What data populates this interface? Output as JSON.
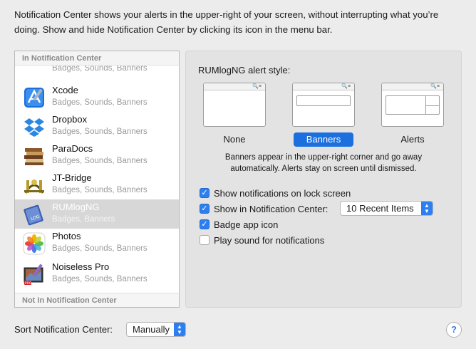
{
  "intro_text": "Notification Center shows your alerts in the upper-right of your screen, without interrupting what you’re doing. Show and hide Notification Center by clicking its icon in the menu bar.",
  "app_list": {
    "section_in": "In Notification Center",
    "section_out": "Not In Notification Center",
    "partial_top_sub": "Badges, Sounds, Banners",
    "apps": [
      {
        "name": "Xcode",
        "sub": "Badges, Sounds, Banners",
        "icon": "xcode-icon",
        "selected": false
      },
      {
        "name": "Dropbox",
        "sub": "Badges, Sounds, Banners",
        "icon": "dropbox-icon",
        "selected": false
      },
      {
        "name": "ParaDocs",
        "sub": "Badges, Sounds, Banners",
        "icon": "paradocs-icon",
        "selected": false
      },
      {
        "name": "JT-Bridge",
        "sub": "Badges, Sounds, Banners",
        "icon": "jt-bridge-icon",
        "selected": false
      },
      {
        "name": "RUMlogNG",
        "sub": "Badges, Banners",
        "icon": "rumlogng-icon",
        "selected": true
      },
      {
        "name": "Photos",
        "sub": "Badges, Sounds, Banners",
        "icon": "photos-icon",
        "selected": false
      },
      {
        "name": "Noiseless Pro",
        "sub": "Badges, Sounds, Banners",
        "icon": "noiseless-pro-icon",
        "selected": false
      }
    ]
  },
  "detail": {
    "style_title": "RUMlogNG alert style:",
    "styles": [
      {
        "label": "None",
        "selected": false
      },
      {
        "label": "Banners",
        "selected": true
      },
      {
        "label": "Alerts",
        "selected": false
      }
    ],
    "description": "Banners appear in the upper-right corner and go away automatically. Alerts stay on screen until dismissed.",
    "options": {
      "lock_screen": {
        "label": "Show notifications on lock screen",
        "checked": true
      },
      "show_in_nc": {
        "label": "Show in Notification Center:",
        "checked": true
      },
      "badge": {
        "label": "Badge app icon",
        "checked": true
      },
      "sound": {
        "label": "Play sound for notifications",
        "checked": false
      }
    },
    "recent_items_value": "10 Recent Items"
  },
  "footer": {
    "sort_label": "Sort Notification Center:",
    "sort_value": "Manually",
    "help_label": "?"
  },
  "colors": {
    "accent": "#2d7ff1",
    "selected_row": "#d7d7d7",
    "banner_selected": "#1b6fde"
  }
}
